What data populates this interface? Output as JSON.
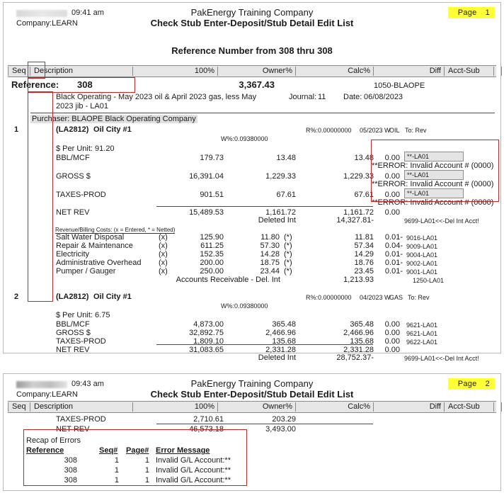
{
  "document": {
    "company_name": "PakEnergy Training Company",
    "report_title": "Check Stub Enter-Deposit/Stub Detail Edit List",
    "company_label": "Company:LEARN",
    "subtitle": "Reference Number from 308 thru 308",
    "page_label": "Page"
  },
  "page1": {
    "time": "09:41 am",
    "page_number": "1",
    "columns": {
      "seq": "Seq",
      "description": "Description",
      "pct100": "100%",
      "owner": "Owner%",
      "calc": "Calc%",
      "diff": "Diff",
      "acct_sub": "Acct-Sub"
    },
    "reference_row": {
      "label": "Reference:",
      "number": "308",
      "amount": "3,367.43",
      "acct_sub": "1050-BLAOPE"
    },
    "memo_line1": "Black Operating - May 2023 oil & April 2023 gas, less May",
    "memo_line2": "2023 jib - LA01",
    "journal_label": "Journal:",
    "journal_value": "11",
    "date_label": "Date:",
    "date_value": "06/08/2023",
    "purchaser_line": "Purchaser: BLAOPE Black Operating Company",
    "sequences": [
      {
        "seq": "1",
        "well_code": "(LA2812)",
        "well_name": "Oil City #1",
        "r_pct": "R%:0.00000000",
        "period": "05/2023 W",
        "product": "OIL",
        "to": "To: Rev",
        "w_pct": "W%:0.09380000",
        "per_unit": "$ Per Unit: 91.20",
        "rows": [
          {
            "desc": "BBL/MCF",
            "p100": "179.73",
            "owner": "13.48",
            "calc": "13.48",
            "diff": "0.00",
            "acct": "**-LA01",
            "error": "**ERROR: Invalid Account # (0000)"
          },
          {
            "desc": "GROSS $",
            "p100": "16,391.04",
            "owner": "1,229.33",
            "calc": "1,229.33",
            "diff": "0.00",
            "acct": "**-LA01",
            "error": "**ERROR: Invalid Account # (0000)"
          },
          {
            "desc": "TAXES-PROD",
            "p100": "901.51",
            "owner": "67.61",
            "calc": "67.61",
            "diff": "0.00",
            "acct": "**-LA01",
            "error": "**ERROR: Invalid Account # (0000)"
          },
          {
            "desc": "NET REV",
            "p100": "15,489.53",
            "owner": "1,161.72",
            "calc": "1,161.72",
            "diff": "0.00",
            "acct": "",
            "error": ""
          }
        ],
        "deleted_int_label": "Deleted Int",
        "deleted_int_value": "14,327.81-",
        "deleted_int_acct": "9699-LA01<<-Del Int Acct!",
        "costs_header": "Revenue/Billing Costs:  (x = Entered, * = Netted)",
        "costs": [
          {
            "desc": "Salt Water Disposal",
            "p100": "125.90",
            "mark1": "(x)",
            "owner": "11.80",
            "mark2": "(*)",
            "calc": "11.81",
            "diff": "0.01-",
            "acct": "9016-LA01"
          },
          {
            "desc": "Repair & Maintenance",
            "p100": "611.25",
            "mark1": "(x)",
            "owner": "57.30",
            "mark2": "(*)",
            "calc": "57.34",
            "diff": "0.04-",
            "acct": "9009-LA01"
          },
          {
            "desc": "Electricity",
            "p100": "152.35",
            "mark1": "(x)",
            "owner": "14.28",
            "mark2": "(*)",
            "calc": "14.29",
            "diff": "0.01-",
            "acct": "9004-LA01"
          },
          {
            "desc": "Administrative Overhead",
            "p100": "200.00",
            "mark1": "(x)",
            "owner": "18.75",
            "mark2": "(*)",
            "calc": "18.76",
            "diff": "0.01-",
            "acct": "9002-LA01"
          },
          {
            "desc": "Pumper / Gauger",
            "p100": "250.00",
            "mark1": "(x)",
            "owner": "23.44",
            "mark2": "(*)",
            "calc": "23.45",
            "diff": "0.01-",
            "acct": "9001-LA01"
          }
        ],
        "ar_label": "Accounts Receivable - Del. Int",
        "ar_value": "1,213.93",
        "ar_acct": "1250-LA01"
      },
      {
        "seq": "2",
        "well_code": "(LA2812)",
        "well_name": "Oil City #1",
        "r_pct": "R%:0.00000000",
        "period": "04/2023 W",
        "product": "GAS",
        "to": "To: Rev",
        "w_pct": "W%:0.09380000",
        "per_unit": "$ Per Unit: 6.75",
        "rows": [
          {
            "desc": "BBL/MCF",
            "p100": "4,873.00",
            "owner": "365.48",
            "calc": "365.48",
            "diff": "0.00",
            "acct": "9621-LA01"
          },
          {
            "desc": "GROSS $",
            "p100": "32,892.75",
            "owner": "2,466.96",
            "calc": "2,466.96",
            "diff": "0.00",
            "acct": "9621-LA01"
          },
          {
            "desc": "TAXES-PROD",
            "p100": "1,809.10",
            "owner": "135.68",
            "calc": "135.68",
            "diff": "0.00",
            "acct": "9622-LA01"
          },
          {
            "desc": "NET REV",
            "p100": "31,083.65",
            "owner": "2,331.28",
            "calc": "2,331.28",
            "diff": "0.00",
            "acct": ""
          }
        ],
        "deleted_int_label": "Deleted Int",
        "deleted_int_value": "28,752.37-",
        "deleted_int_acct": "9699-LA01<<-Del Int Acct!"
      }
    ]
  },
  "page2": {
    "time": "09:43 am",
    "page_number": "2",
    "columns": {
      "seq": "Seq",
      "description": "Description",
      "pct100": "100%",
      "owner": "Owner%",
      "calc": "Calc%",
      "diff": "Diff",
      "acct_sub": "Acct-Sub"
    },
    "rows": [
      {
        "desc": "TAXES-PROD",
        "p100": "2,710.61",
        "owner": "203.29"
      },
      {
        "desc": "NET REV",
        "p100": "46,573.18",
        "owner": "3,493.00"
      }
    ],
    "recap": {
      "title": "Recap of Errors",
      "headers": {
        "reference": "Reference",
        "seq": "Seq#",
        "page": "Page#",
        "message": "Error Message"
      },
      "rows": [
        {
          "reference": "308",
          "seq": "1",
          "page": "1",
          "message": "Invalid  G/L Account:**"
        },
        {
          "reference": "308",
          "seq": "1",
          "page": "1",
          "message": "Invalid  G/L Account:**"
        },
        {
          "reference": "308",
          "seq": "1",
          "page": "1",
          "message": "Invalid  G/L Account:**"
        }
      ]
    }
  },
  "colors": {
    "annotation": "#cc2222",
    "page_badge": "#ffff33",
    "header_fill": "#e6e6e6"
  }
}
